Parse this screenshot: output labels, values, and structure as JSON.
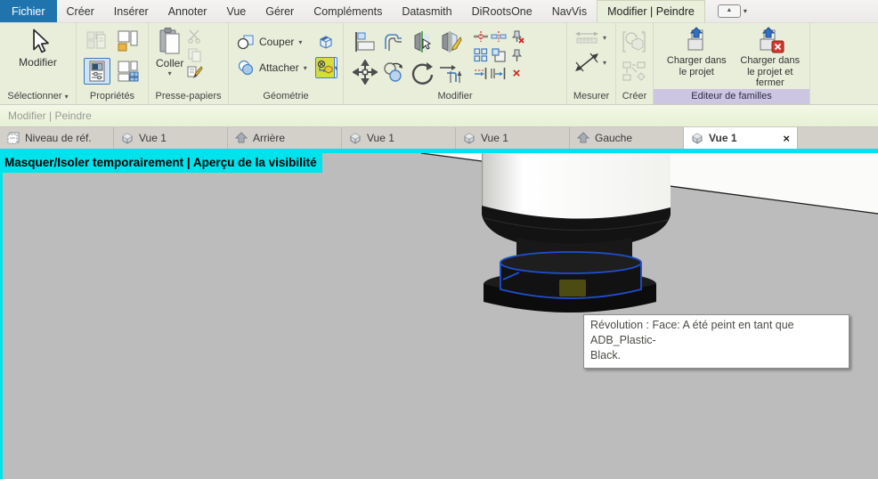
{
  "menubar": {
    "tabs": [
      {
        "label": "Fichier"
      },
      {
        "label": "Créer"
      },
      {
        "label": "Insérer"
      },
      {
        "label": "Annoter"
      },
      {
        "label": "Vue"
      },
      {
        "label": "Gérer"
      },
      {
        "label": "Compléments"
      },
      {
        "label": "Datasmith"
      },
      {
        "label": "DiRootsOne"
      },
      {
        "label": "NavVis"
      },
      {
        "label": "Modifier | Peindre"
      }
    ]
  },
  "glyphs": {
    "dropdown": "▾",
    "collapse": "▲",
    "close": "×",
    "delete": "×"
  },
  "ribbon": {
    "select_panel": {
      "button": "Modifier",
      "label": "Sélectionner"
    },
    "properties_panel": {
      "label": "Propriétés"
    },
    "clipboard_panel": {
      "paste": "Coller",
      "label": "Presse-papiers"
    },
    "geometry_panel": {
      "cut": "Couper",
      "join": "Attacher",
      "label": "Géométrie"
    },
    "modify_panel": {
      "label": "Modifier"
    },
    "measure_panel": {
      "label": "Mesurer"
    },
    "create_panel": {
      "label": "Créer"
    },
    "family_editor_panel": {
      "load": "Charger dans le projet",
      "load_close": "Charger dans le projet et fermer",
      "label": "Editeur de familles"
    }
  },
  "options_bar": {
    "text": "Modifier | Peindre"
  },
  "view_tabs": [
    {
      "label": "Niveau de réf.",
      "icon": "plan"
    },
    {
      "label": "Vue 1",
      "icon": "3d"
    },
    {
      "label": "Arrière",
      "icon": "elevation"
    },
    {
      "label": "Vue 1",
      "icon": "3d"
    },
    {
      "label": "Vue 1",
      "icon": "3d"
    },
    {
      "label": "Gauche",
      "icon": "elevation"
    },
    {
      "label": "Vue 1",
      "icon": "3d",
      "active": true
    }
  ],
  "viewport": {
    "banner": "Masquer/Isoler temporairement | Aperçu de la visibilité",
    "tooltip_line1": "Révolution : Face: A été peint en tant que ADB_Plastic-",
    "tooltip_line2": "Black.",
    "colors": {
      "isolate_border": "#00e2ec",
      "background": "#bcbcbc",
      "selection_blue": "#1e4fd0",
      "painted_label_olive": "#4c4c12",
      "file_tab_blue": "#1f74ad",
      "context_tab_green": "#e9efdb",
      "family_footer_lavender": "#ccc6e2",
      "paint_highlight": "#d4dd3a"
    }
  }
}
